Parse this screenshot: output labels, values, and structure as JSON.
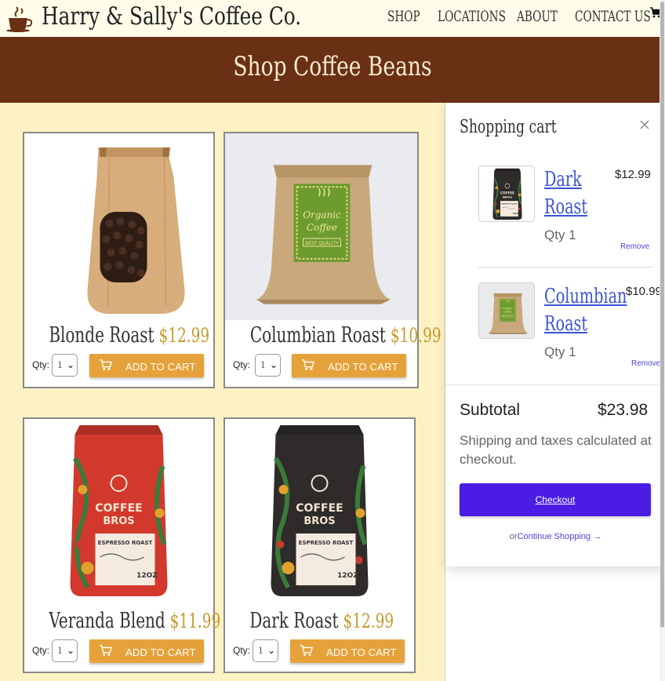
{
  "header": {
    "brand": "Harry & Sally's Coffee Co.",
    "logo_icon": "coffee-cup-icon",
    "nav": [
      {
        "label": "SHOP"
      },
      {
        "label": "LOCATIONS"
      },
      {
        "label": "ABOUT"
      },
      {
        "label": "CONTACT US"
      }
    ],
    "cart_icon": "cart-icon"
  },
  "hero": {
    "title": "Shop Coffee Beans"
  },
  "products": [
    {
      "name": "Blonde Roast",
      "price": "$12.99",
      "qty_label": "Qty:",
      "qty_value": "1",
      "button": "ADD TO CART"
    },
    {
      "name": "Columbian Roast",
      "price": "$10.99",
      "qty_label": "Qty:",
      "qty_value": "1",
      "button": "ADD TO CART"
    },
    {
      "name": "Veranda Blend",
      "price": "$11.99",
      "qty_label": "Qty:",
      "qty_value": "1",
      "button": "ADD TO CART"
    },
    {
      "name": "Dark Roast",
      "price": "$12.99",
      "qty_label": "Qty:",
      "qty_value": "1",
      "button": "ADD TO CART"
    }
  ],
  "cart": {
    "title": "Shopping cart",
    "close_icon": "close-icon",
    "items": [
      {
        "name_line1": "Dark",
        "name_line2": "Roast",
        "price": "$12.99",
        "qty": "Qty 1",
        "remove": "Remove"
      },
      {
        "name_line1": "Columbian",
        "name_line2": "Roast",
        "price": "$10.99",
        "qty": "Qty 1",
        "remove": "Remove"
      }
    ],
    "subtotal_label": "Subtotal",
    "subtotal_value": "$23.98",
    "shipping_note": "Shipping and taxes calculated at checkout.",
    "checkout_label": "Checkout",
    "or_text": "or",
    "continue_label": "Continue Shopping →"
  },
  "colors": {
    "page_bg": "#fdf2c4",
    "hero_bg": "#6a3013",
    "accent_orange": "#e5a23a",
    "price_gold": "#c79a2e",
    "checkout_purple": "#4b1de4",
    "link_blue": "#3b55d4"
  }
}
